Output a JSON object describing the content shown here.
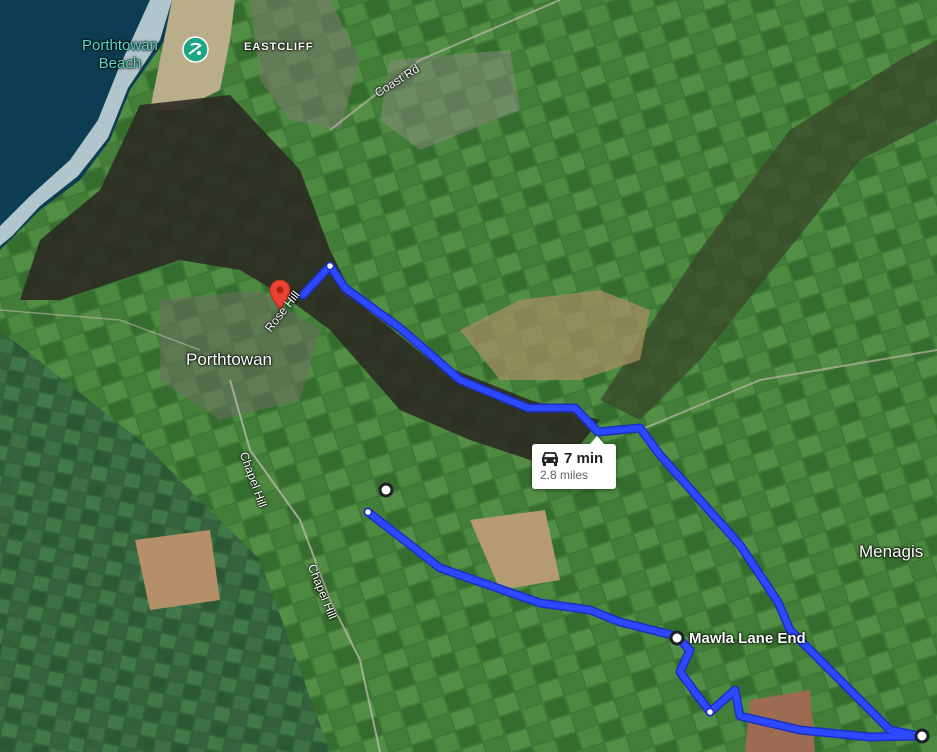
{
  "map": {
    "labels": {
      "porthtowan_beach_line1": "Porthtowan",
      "porthtowan_beach_line2": "Beach",
      "eastcliff": "EASTCLIFF",
      "coast_rd": "Coast Rd",
      "rose_hill": "Rose Hill",
      "porthtowan": "Porthtowan",
      "chapel_hill_upper": "Chapel Hill",
      "chapel_hill_lower": "Chapel Hill",
      "menagissey": "Menagis"
    },
    "waypoints": {
      "mawla_lane_end": "Mawla Lane End"
    },
    "route_callout": {
      "mode_icon": "car-icon",
      "time": "7 min",
      "distance": "2.8 miles"
    },
    "colors": {
      "route": "#2c49ff",
      "route_outline": "#1d2fc0",
      "pin": "#ea4335",
      "beach_poi": "#1ea784"
    }
  }
}
